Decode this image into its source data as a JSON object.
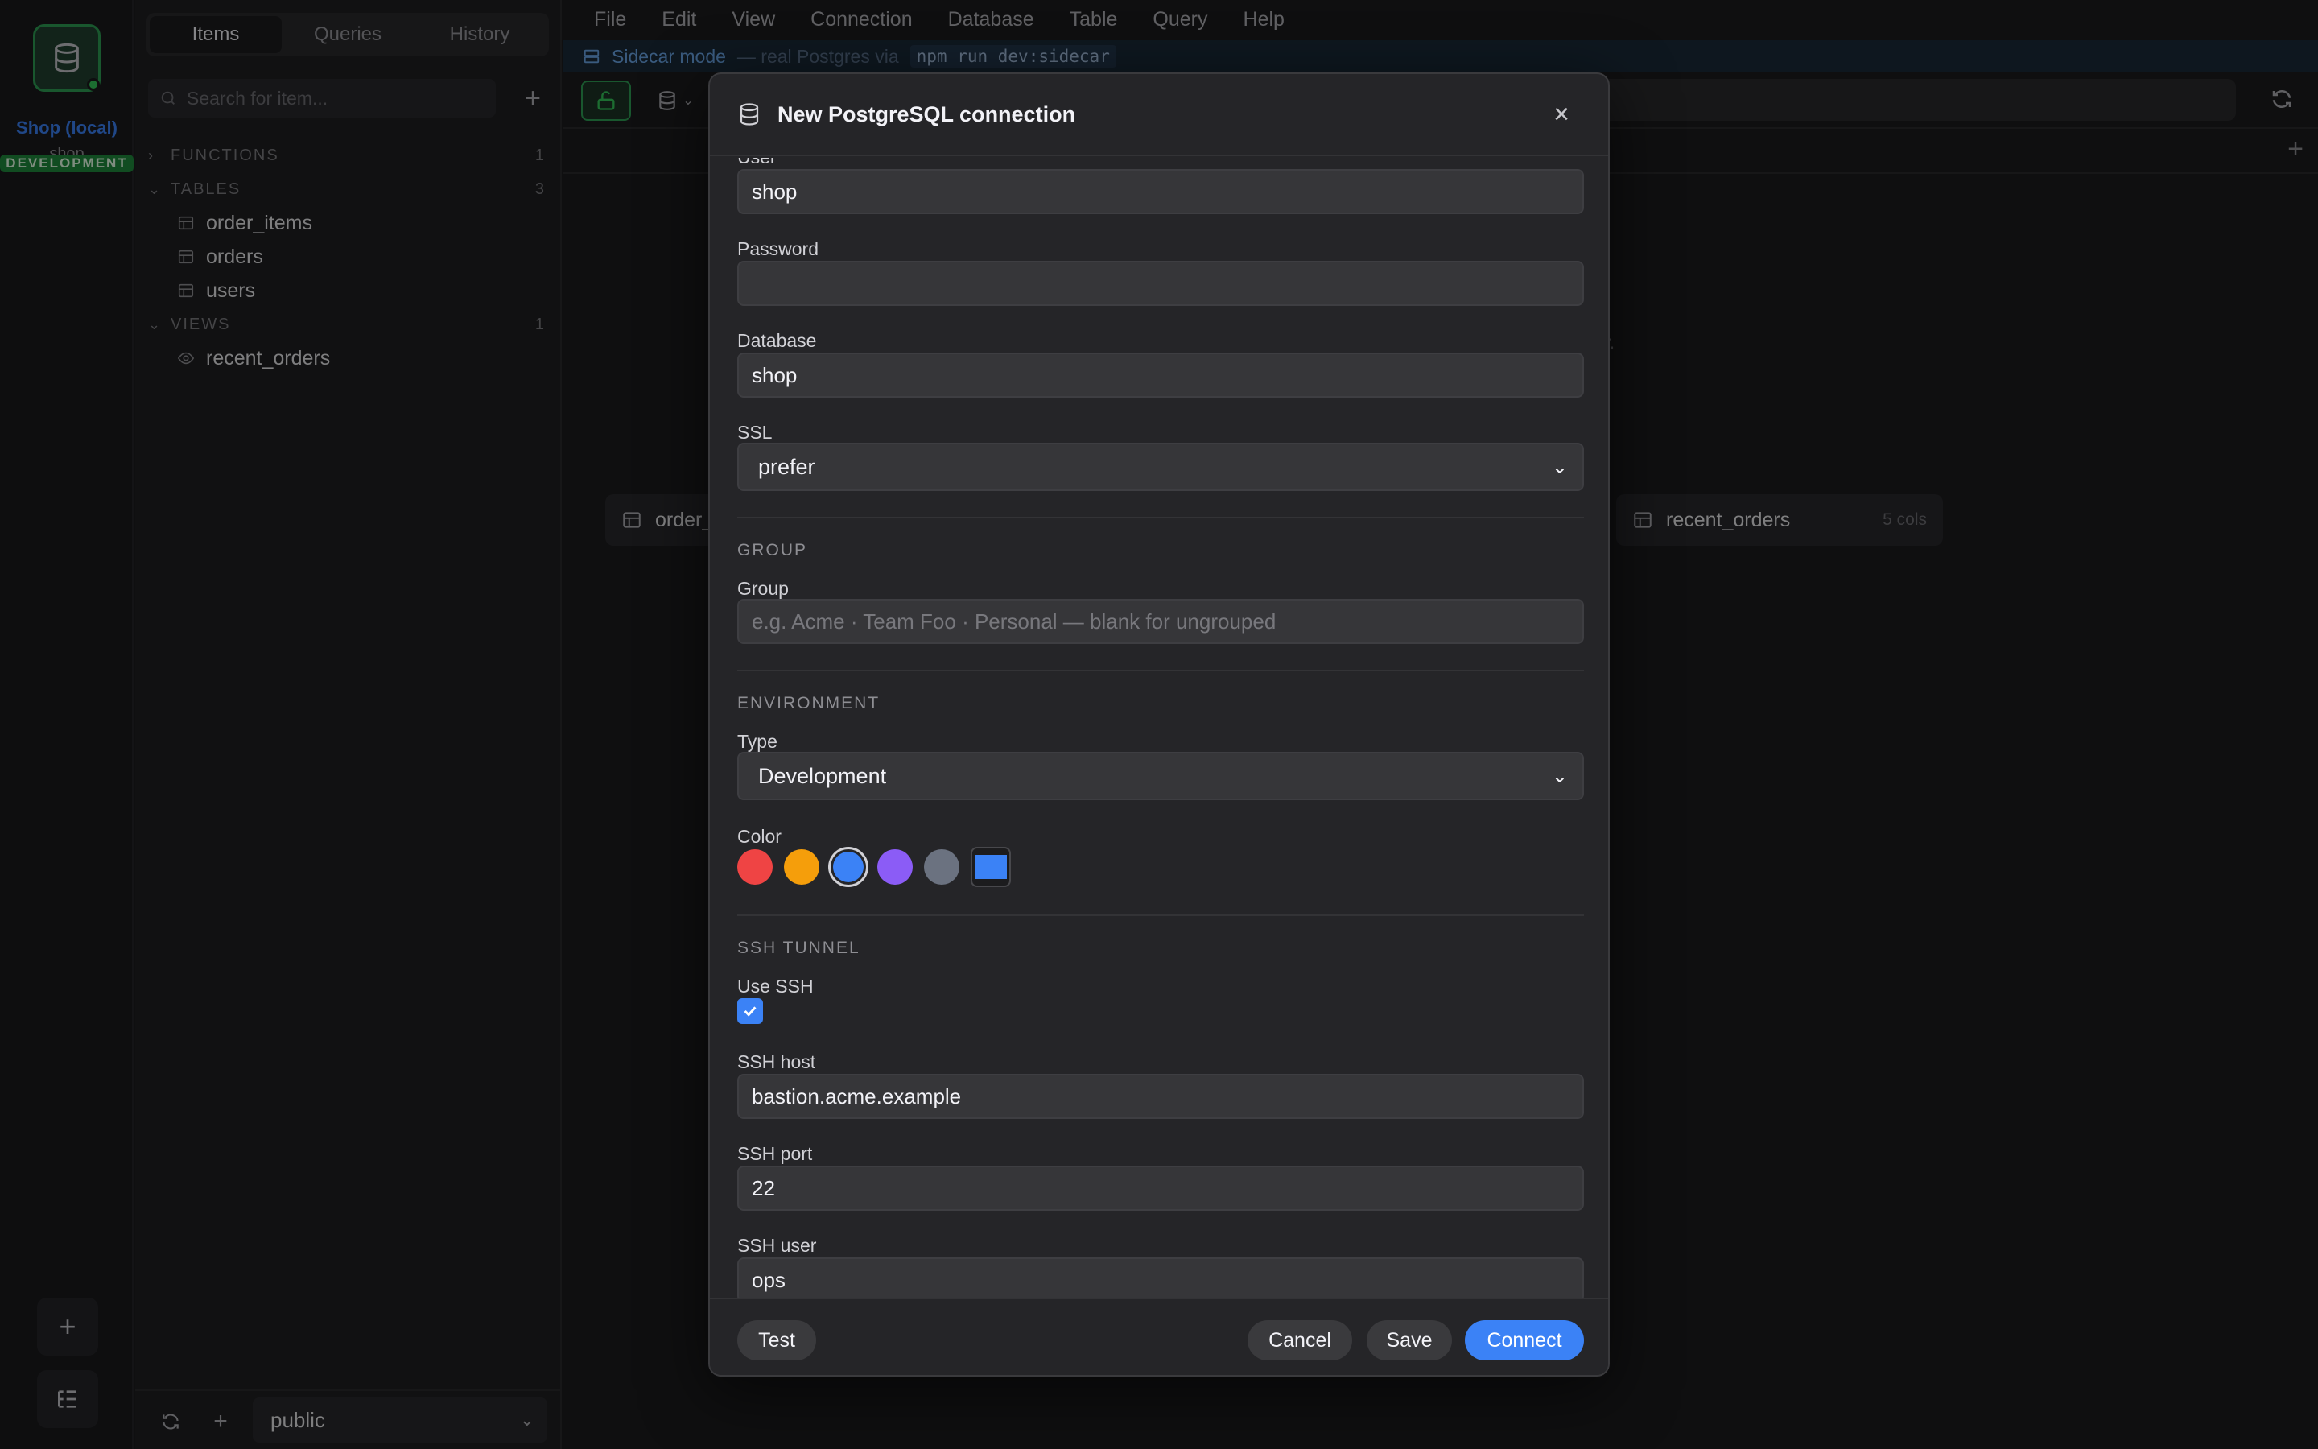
{
  "rail": {
    "connection_name": "Shop (local)",
    "connection_db": "shop",
    "env_badge": "DEVELOPMENT"
  },
  "sidebar": {
    "tabs": [
      {
        "label": "Items",
        "active": true
      },
      {
        "label": "Queries",
        "active": false
      },
      {
        "label": "History",
        "active": false
      }
    ],
    "search_placeholder": "Search for item...",
    "sections": [
      {
        "label": "FUNCTIONS",
        "count": "1",
        "items": []
      },
      {
        "label": "TABLES",
        "count": "3",
        "items": [
          "order_items",
          "orders",
          "users"
        ]
      },
      {
        "label": "VIEWS",
        "count": "1",
        "items": [
          "recent_orders"
        ]
      }
    ],
    "schema": "public"
  },
  "menubar": [
    "File",
    "Edit",
    "View",
    "Connection",
    "Database",
    "Table",
    "Query",
    "Help"
  ],
  "sidecar": {
    "label": "Sidecar mode",
    "detail": "— real Postgres via",
    "command": "npm run dev:sidecar"
  },
  "background": {
    "hint_tail": "y.",
    "cards": [
      {
        "name": "order_",
        "cols": ""
      },
      {
        "name": "recent_orders",
        "cols": "5 cols"
      }
    ]
  },
  "modal": {
    "title": "New PostgreSQL connection",
    "user_label": "User",
    "user_value": "shop",
    "password_label": "Password",
    "password_value": "",
    "database_label": "Database",
    "database_value": "shop",
    "ssl_label": "SSL",
    "ssl_value": "prefer",
    "group_section": "GROUP",
    "group_label": "Group",
    "group_placeholder": "e.g. Acme · Team Foo · Personal — blank for ungrouped",
    "environment_section": "ENVIRONMENT",
    "type_label": "Type",
    "type_value": "Development",
    "color_label": "Color",
    "colors": [
      "#ef4444",
      "#f59e0b",
      "#3b82f6",
      "#8b5cf6",
      "#6b7280"
    ],
    "selected_color": "#3b82f6",
    "ssh_section": "SSH TUNNEL",
    "use_ssh_label": "Use SSH",
    "use_ssh_checked": true,
    "ssh_host_label": "SSH host",
    "ssh_host_value": "bastion.acme.example",
    "ssh_port_label": "SSH port",
    "ssh_port_value": "22",
    "ssh_user_label": "SSH user",
    "ssh_user_value": "ops",
    "buttons": {
      "test": "Test",
      "cancel": "Cancel",
      "save": "Save",
      "connect": "Connect"
    }
  },
  "icons": {
    "database": "database-icon",
    "lock": "unlock-icon",
    "close": "close-icon",
    "refresh": "refresh-icon",
    "table": "table-icon",
    "view": "eye-icon",
    "plus": "plus-icon",
    "chevron": "chevron-down-icon"
  }
}
